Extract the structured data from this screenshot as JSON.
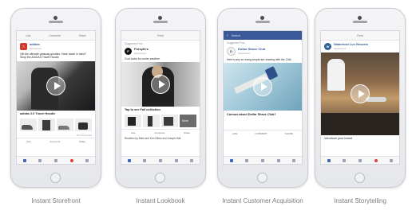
{
  "phones": [
    {
      "label": "Instant Storefront",
      "tabs": [
        "Like",
        "Comment",
        "Share"
      ],
      "brand": "adidas",
      "brand_sub": "Sponsored",
      "caption": "Gift the ultimate getaway goodies. Have travel in mind? Shop the ADIDAS Travel Hoodie",
      "product_title": "adidas 2.0 Travel Hoodie",
      "like_count": "2K Comments"
    },
    {
      "label": "Instant Lookbook",
      "top_label": "Feed",
      "sponsored": "Suggested Post",
      "brand": "Forsyth's",
      "brand_sub": "Sponsored",
      "caption": "Cool looks for cooler weather.",
      "cta": "Tap to see Fall collection",
      "more": "More",
      "actions": [
        "Like",
        "Comment",
        "Share"
      ],
      "footer_text": "Reaction by Mark and Ken Dikes and Joseph Hall"
    },
    {
      "label": "Instant Customer Acquisition",
      "search": "Search",
      "sponsored": "Suggested Post",
      "brand": "Dollar Shave Club",
      "brand_sub": "Sponsored",
      "caption": "Here's why so many people are shaving with the Club.",
      "cta": "Curious about Dollar Shave Club?",
      "actions": [
        "LIKE",
        "COMMENT",
        "SHARE"
      ]
    },
    {
      "label": "Instant Storytelling",
      "top_label": "Feed",
      "brand": "Waterford Lux Resorts",
      "brand_sub": "Sponsored",
      "caption": "Introduce your brand"
    }
  ],
  "colors": {
    "facebook_blue": "#3b5998",
    "link_blue": "#365899",
    "label_gray": "#7a7d82"
  }
}
